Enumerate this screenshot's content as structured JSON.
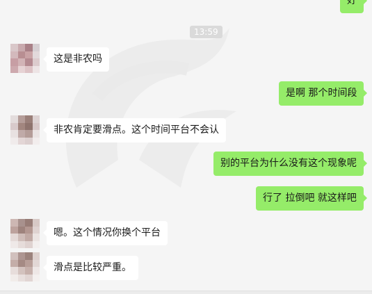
{
  "chat": {
    "timestamp": "13:59",
    "messages": [
      {
        "side": "out",
        "text": "好"
      },
      {
        "side": "in",
        "text": "这是非农吗"
      },
      {
        "side": "out",
        "text": "是啊 那个时间段"
      },
      {
        "side": "in",
        "text": "非农肯定要滑点。这个时间平台不会认"
      },
      {
        "side": "out",
        "text": "别的平台为什么没有这个现象呢"
      },
      {
        "side": "out",
        "text": "行了 拉倒吧  就这样吧"
      },
      {
        "side": "in",
        "text": "嗯。这个情况你换个平台"
      },
      {
        "side": "in",
        "text": "滑点是比较严重。"
      }
    ]
  },
  "colors": {
    "background": "#f5f5f5",
    "incoming_bubble": "#ffffff",
    "outgoing_bubble": "#95ec69",
    "timestamp_bg": "#dadada"
  }
}
